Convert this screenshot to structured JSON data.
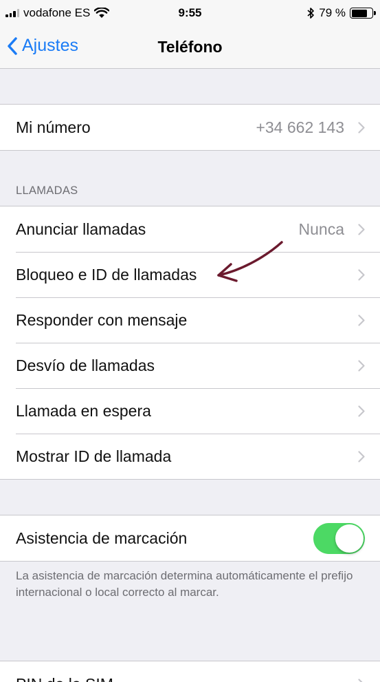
{
  "status_bar": {
    "carrier": "vodafone ES",
    "time": "9:55",
    "battery_text": "79 %",
    "battery_level": 0.79,
    "icons": [
      "signal-icon",
      "wifi-icon",
      "bluetooth-icon",
      "battery-icon"
    ]
  },
  "nav": {
    "back_label": "Ajustes",
    "title": "Teléfono"
  },
  "my_number": {
    "label": "Mi número",
    "value": "+34 662 143"
  },
  "calls_section": {
    "header": "LLAMADAS",
    "items": [
      {
        "label": "Anunciar llamadas",
        "value": "Nunca"
      },
      {
        "label": "Bloqueo e ID de llamadas"
      },
      {
        "label": "Responder con mensaje"
      },
      {
        "label": "Desvío de llamadas"
      },
      {
        "label": "Llamada en espera"
      },
      {
        "label": "Mostrar ID de llamada"
      }
    ]
  },
  "dial_assist": {
    "label": "Asistencia de marcación",
    "enabled": true,
    "footer": "La asistencia de marcación determina automáticamente el prefijo internacional o local correcto al marcar."
  },
  "sim_pin": {
    "label": "PIN de la SIM"
  },
  "colors": {
    "accent": "#1b7cf6",
    "toggle_on": "#4cd964",
    "annotation": "#6b1a2e",
    "background": "#efeff4"
  }
}
